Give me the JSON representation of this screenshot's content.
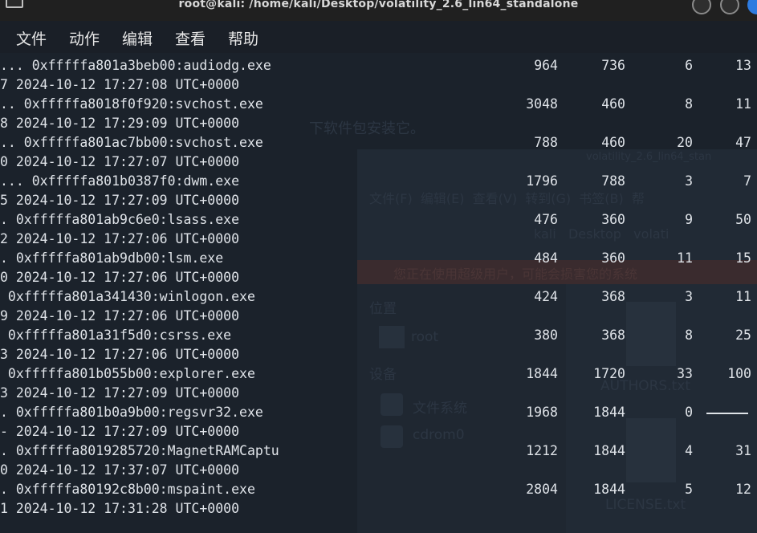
{
  "window": {
    "title": "root@kali: /home/kali/Desktop/volatility_2.6_lin64_standalone"
  },
  "menu": {
    "file": "文件",
    "actions": "动作",
    "edit": "编辑",
    "view": "查看",
    "help": "帮助"
  },
  "ghost": {
    "hint": "下软件包安装它。",
    "menubar": "文件(F)  编辑(E)  查看(V)  转到(G)  书签(B)  帮",
    "path": "kali   Desktop   volati",
    "warning": "您正在使用超级用户，可能会损害您的系统",
    "sidebar_places": "位置",
    "root": "root",
    "devices": "设备",
    "filesystem": "文件系统",
    "cdrom": "cdrom0",
    "file1": "AUTHORS.txt",
    "file2": "LICENSE.txt",
    "title": "volatility_2.6_lin64_stan"
  },
  "processes": [
    {
      "prefix": "...",
      "offset_name": "0xfffffa801a3beb00:audiodg.exe",
      "pid": "964",
      "ppid": "736",
      "thds": "6",
      "hnds": "13",
      "time_prefix": "7",
      "time": "2024-10-12 17:27:08 UTC+0000"
    },
    {
      "prefix": "..",
      "offset_name": "0xfffffa8018f0f920:svchost.exe",
      "pid": "3048",
      "ppid": "460",
      "thds": "8",
      "hnds": "11",
      "time_prefix": "8",
      "time": "2024-10-12 17:29:09 UTC+0000"
    },
    {
      "prefix": "..",
      "offset_name": "0xfffffa801ac7bb00:svchost.exe",
      "pid": "788",
      "ppid": "460",
      "thds": "20",
      "hnds": "47",
      "time_prefix": "0",
      "time": "2024-10-12 17:27:07 UTC+0000"
    },
    {
      "prefix": "...",
      "offset_name": "0xfffffa801b0387f0:dwm.exe",
      "pid": "1796",
      "ppid": "788",
      "thds": "3",
      "hnds": "7",
      "time_prefix": "5",
      "time": "2024-10-12 17:27:09 UTC+0000"
    },
    {
      "prefix": ".",
      "offset_name": "0xfffffa801ab9c6e0:lsass.exe",
      "pid": "476",
      "ppid": "360",
      "thds": "9",
      "hnds": "50",
      "time_prefix": "2",
      "time": "2024-10-12 17:27:06 UTC+0000"
    },
    {
      "prefix": ".",
      "offset_name": "0xfffffa801ab9db00:lsm.exe",
      "pid": "484",
      "ppid": "360",
      "thds": "11",
      "hnds": "15",
      "time_prefix": "0",
      "time": "2024-10-12 17:27:06 UTC+0000"
    },
    {
      "prefix": "",
      "offset_name": "0xfffffa801a341430:winlogon.exe",
      "pid": "424",
      "ppid": "368",
      "thds": "3",
      "hnds": "11",
      "time_prefix": "9",
      "time": "2024-10-12 17:27:06 UTC+0000"
    },
    {
      "prefix": "",
      "offset_name": "0xfffffa801a31f5d0:csrss.exe",
      "pid": "380",
      "ppid": "368",
      "thds": "8",
      "hnds": "25",
      "time_prefix": "3",
      "time": "2024-10-12 17:27:06 UTC+0000"
    },
    {
      "prefix": "",
      "offset_name": "0xfffffa801b055b00:explorer.exe",
      "pid": "1844",
      "ppid": "1720",
      "thds": "33",
      "hnds": "100",
      "time_prefix": "3",
      "time": "2024-10-12 17:27:09 UTC+0000"
    },
    {
      "prefix": ".",
      "offset_name": "0xfffffa801b0a9b00:regsvr32.exe",
      "pid": "1968",
      "ppid": "1844",
      "thds": "0",
      "hnds": "",
      "time_prefix": "-",
      "time": "2024-10-12 17:27:09 UTC+0000"
    },
    {
      "prefix": ".",
      "offset_name": "0xfffffa8019285720:MagnetRAMCaptu",
      "pid": "1212",
      "ppid": "1844",
      "thds": "4",
      "hnds": "31",
      "time_prefix": "0",
      "time": "2024-10-12 17:37:07 UTC+0000"
    },
    {
      "prefix": ".",
      "offset_name": "0xfffffa80192c8b00:mspaint.exe",
      "pid": "2804",
      "ppid": "1844",
      "thds": "5",
      "hnds": "12",
      "time_prefix": "1",
      "time": "2024-10-12 17:31:28 UTC+0000"
    }
  ]
}
